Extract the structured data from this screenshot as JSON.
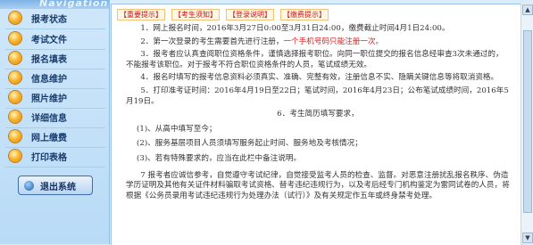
{
  "sidebar": {
    "header": "Navigation",
    "items": [
      {
        "label": "报考状态"
      },
      {
        "label": "考试文件"
      },
      {
        "label": "报名填表"
      },
      {
        "label": "信息维护"
      },
      {
        "label": "照片维护"
      },
      {
        "label": "详细信息"
      },
      {
        "label": "网上缴费"
      },
      {
        "label": "打印表格"
      }
    ],
    "logout_label": "退出系统"
  },
  "tabs": [
    {
      "label": "【重要提示】"
    },
    {
      "label": "【考生须知】"
    },
    {
      "label": "【登录说明】"
    },
    {
      "label": "【缴费提示】"
    }
  ],
  "notice": {
    "p1": "1．网上报名时间，2016年3月27日0:00至3月31日24:00，缴费截止时间4月1日24:00。",
    "p2_prefix": "2．第一次登录的考生需要首先进行注册，",
    "p2_red": "一个手机号码只能注册一次。",
    "p3": "3．报考者应认真查阅职位资格条件，谨慎选择报考职位。向同一职位提交的报名信息经审查3次未通过的，不能报考该职位。对于报考不符合职位资格条件的人员，笔试成绩无效。",
    "p4": "4．报名时填写的报考信息资料必须真实、准确、完整有效，注册信息不实、隐瞒关键信息等将取消资格。",
    "p5": "5．打印准考证时间：2016年4月19日至22日；笔试时间，2016年4月23日；公布笔试成绩时间，2016年5月19日。",
    "p6_title": "6．考生简历填写要求，",
    "p6_items": [
      "(1)、从高中填写至今；",
      "(2)、服务基层项目人员须填写服务起止时间、服务地及考核情况；",
      "(3)、若有特殊要求的，应当在此栏中备注说明。"
    ],
    "p7": "7 报考者应诚信参考，自觉遵守考试纪律，自觉接受监考人员的检查、监督。对恶意注册扰乱报名秩序、伪造学历证明及其他有关证件材料骗取考试资格、替考违纪违规行为，以及考后经专门机构鉴定为雷同试卷的人员，将根据《公务员录用考试违纪违规行为处理办法（试行）》及有关规定作五年或终身禁考处理。"
  }
}
